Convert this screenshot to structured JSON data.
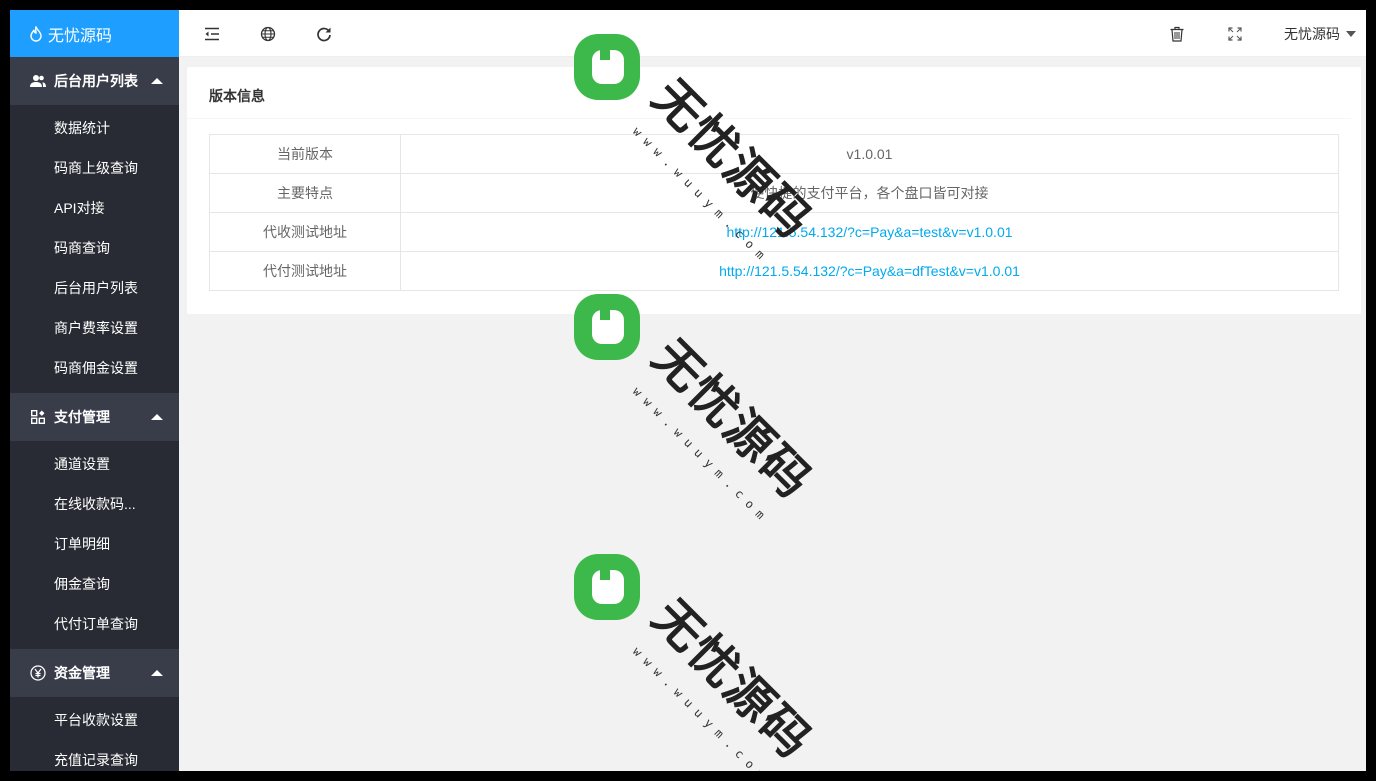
{
  "app": {
    "logo_text": "无忧源码",
    "user_name": "无忧源码"
  },
  "sidebar": {
    "groups": [
      {
        "title": "后台用户列表",
        "icon": "users-icon",
        "items": [
          "数据统计",
          "码商上级查询",
          "API对接",
          "码商查询",
          "后台用户列表",
          "商户费率设置",
          "码商佣金设置"
        ]
      },
      {
        "title": "支付管理",
        "icon": "apps-icon",
        "items": [
          "通道设置",
          "在线收款码...",
          "订单明细",
          "佣金查询",
          "代付订单查询"
        ]
      },
      {
        "title": "资金管理",
        "icon": "yen-icon",
        "items": [
          "平台收款设置",
          "充值记录查询"
        ]
      }
    ]
  },
  "toolbar": {
    "icons": [
      "menu-fold-icon",
      "globe-icon",
      "refresh-icon",
      "trash-icon",
      "fullscreen-icon"
    ]
  },
  "card": {
    "title": "版本信息",
    "rows": [
      {
        "label": "当前版本",
        "value": "v1.0.01",
        "link": false
      },
      {
        "label": "主要特点",
        "value": "便快捷的支付平台，各个盘口皆可对接",
        "link": false
      },
      {
        "label": "代收测试地址",
        "value": "http://121.5.54.132/?c=Pay&a=test&v=v1.0.01",
        "link": true
      },
      {
        "label": "代付测试地址",
        "value": "http://121.5.54.132/?c=Pay&a=dfTest&v=v1.0.01",
        "link": true
      }
    ]
  },
  "watermark": {
    "text": "无忧源码",
    "url": "w w w . w u u y m . c o m",
    "color": "#3db84a"
  }
}
